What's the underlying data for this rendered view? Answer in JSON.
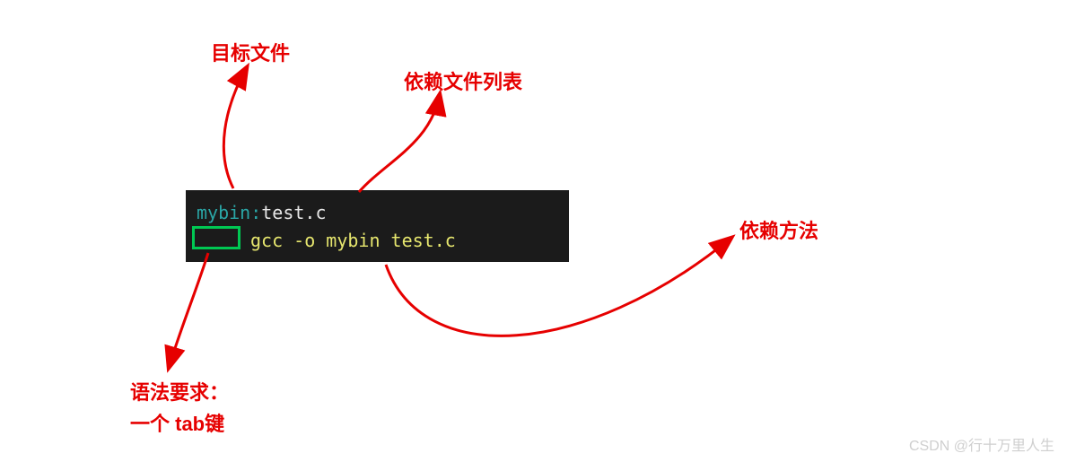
{
  "labels": {
    "target_file": "目标文件",
    "dep_list": "依赖文件列表",
    "dep_method": "依赖方法",
    "syntax_line1": "语法要求：",
    "syntax_line2": "一个 tab键"
  },
  "code": {
    "target": "mybin",
    "separator": ":",
    "deps": "test.c",
    "command": "gcc -o mybin test.c"
  },
  "watermark": "CSDN @行十万里人生"
}
